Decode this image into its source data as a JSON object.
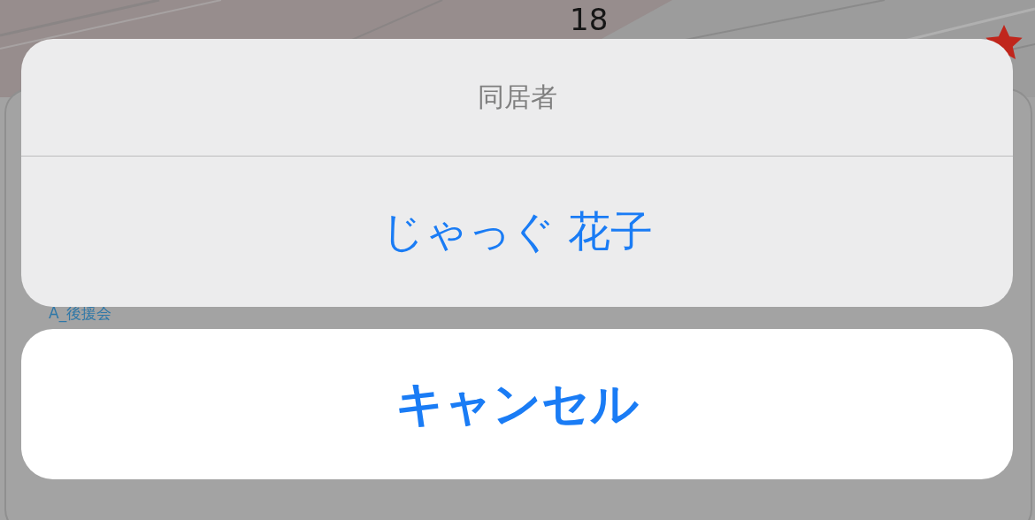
{
  "map": {
    "map_label": "18"
  },
  "record": {
    "group_label": "A_後援会"
  },
  "action_sheet": {
    "title": "同居者",
    "options": [
      "じゃっぐ 花子"
    ],
    "cancel": "キャンセル"
  }
}
